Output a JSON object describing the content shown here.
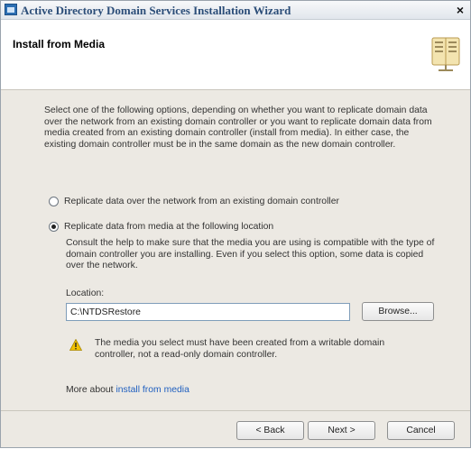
{
  "window": {
    "title": "Active Directory Domain Services Installation Wizard",
    "close_label": "×"
  },
  "header": {
    "title": "Install from Media"
  },
  "intro_text": "Select one of the following options, depending on whether you want to replicate domain data over the network from an existing domain controller or you want to replicate domain data from media created from an existing domain controller (install from media). In either case, the existing domain controller must be in the same domain as the new domain controller.",
  "options": [
    {
      "label": "Replicate data over the network from an existing domain controller",
      "selected": false
    },
    {
      "label": "Replicate data from media at the following location",
      "selected": true
    }
  ],
  "help_text": "Consult the help to make sure that the media you are using is compatible with the type of domain controller you are installing. Even if you select this option, some data is copied over the network.",
  "location": {
    "label": "Location:",
    "value": "C:\\NTDSRestore",
    "browse_label": "Browse..."
  },
  "warning_text": "The media you select must have been created from a writable domain controller, not a read-only domain controller.",
  "more_about": {
    "prefix": "More about ",
    "link": "install from media"
  },
  "buttons": {
    "back": "< Back",
    "next": "Next >",
    "cancel": "Cancel"
  },
  "colors": {
    "title_text": "#2b4d78",
    "link": "#1f5fbf",
    "warning": "#f2c200"
  }
}
